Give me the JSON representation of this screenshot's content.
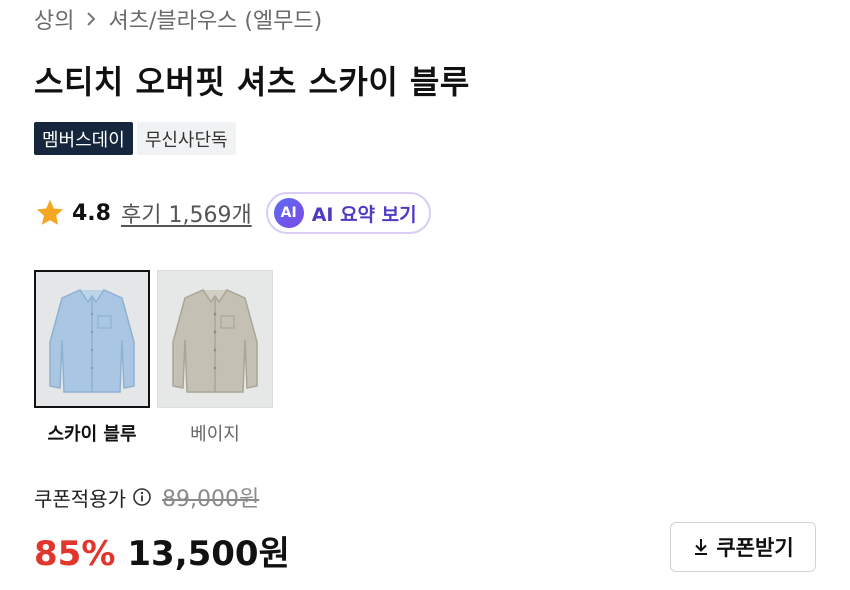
{
  "breadcrumb": {
    "category": "상의",
    "subcategory": "셔츠/블라우스 (엘무드)",
    "separator_icon": "chevron-right-icon"
  },
  "product": {
    "title": "스티치 오버핏 셔츠 스카이 블루",
    "badges": [
      "멤버스데이",
      "무신사단독"
    ]
  },
  "rating": {
    "value": "4.8",
    "reviews_label": "후기 1,569개",
    "icon": "star-icon",
    "star_color": "#f5a623",
    "ai_button": {
      "icon_text": "AI",
      "label": "AI 요약 보기"
    }
  },
  "colors": {
    "options": [
      {
        "label": "스카이 블루",
        "selected": true,
        "swatch": "#a9c7e2"
      },
      {
        "label": "베이지",
        "selected": false,
        "swatch": "#c4c0b4"
      }
    ]
  },
  "price": {
    "coupon_label": "쿠폰적용가",
    "original": "89,000원",
    "discount": "85%",
    "final": "13,500원",
    "discount_color": "#e0362c",
    "coupon_button": "쿠폰받기"
  }
}
